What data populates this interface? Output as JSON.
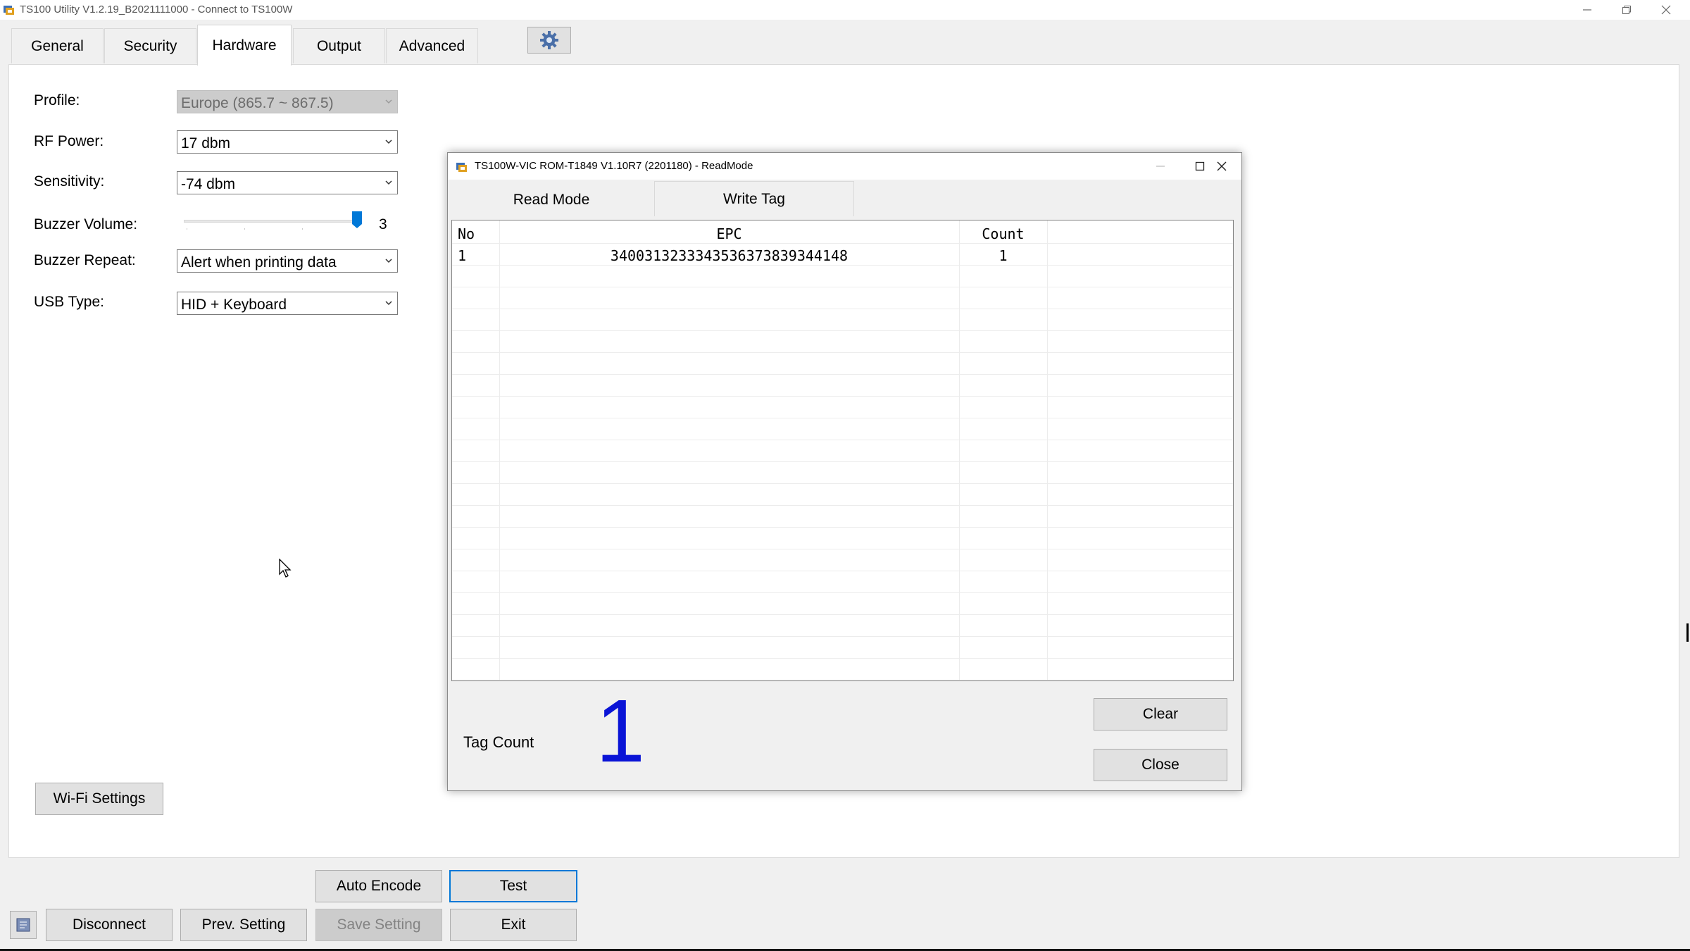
{
  "window": {
    "title": "TS100 Utility V1.2.19_B2021111000 - Connect to TS100W"
  },
  "tabs": [
    {
      "label": "General",
      "active": false
    },
    {
      "label": "Security",
      "active": false
    },
    {
      "label": "Hardware",
      "active": true
    },
    {
      "label": "Output",
      "active": false
    },
    {
      "label": "Advanced",
      "active": false
    }
  ],
  "hardware": {
    "profile": {
      "label": "Profile:",
      "value": "Europe (865.7 ~ 867.5)",
      "disabled": true
    },
    "rf_power": {
      "label": "RF Power:",
      "value": "17 dbm"
    },
    "sensitivity": {
      "label": "Sensitivity:",
      "value": "-74 dbm"
    },
    "buzzer_volume": {
      "label": "Buzzer Volume:",
      "value": "3",
      "level_fraction": 1.0
    },
    "buzzer_repeat": {
      "label": "Buzzer Repeat:",
      "value": "Alert when printing data"
    },
    "usb_type": {
      "label": "USB Type:",
      "value": "HID + Keyboard"
    },
    "wifi_settings_label": "Wi-Fi Settings"
  },
  "bottom_buttons": {
    "auto_encode": "Auto Encode",
    "test": "Test",
    "disconnect": "Disconnect",
    "prev_setting": "Prev. Setting",
    "save_setting": "Save Setting",
    "exit": "Exit"
  },
  "dialog": {
    "title": "TS100W-VIC ROM-T1849 V1.10R7 (2201180) - ReadMode",
    "tabs": [
      {
        "label": "Read Mode",
        "active": true
      },
      {
        "label": "Write Tag",
        "active": false
      }
    ],
    "table": {
      "columns": [
        "No",
        "EPC",
        "Count"
      ],
      "rows": [
        {
          "no": "1",
          "epc": "3400313233343536373839344148",
          "count": "1"
        }
      ]
    },
    "tag_count_label": "Tag Count",
    "tag_count_value": "1",
    "clear_label": "Clear",
    "close_label": "Close"
  },
  "colors": {
    "accent": "#0078d7",
    "tag_count": "#0a14d6",
    "panel": "#ffffff",
    "chrome": "#f0f0f0"
  }
}
